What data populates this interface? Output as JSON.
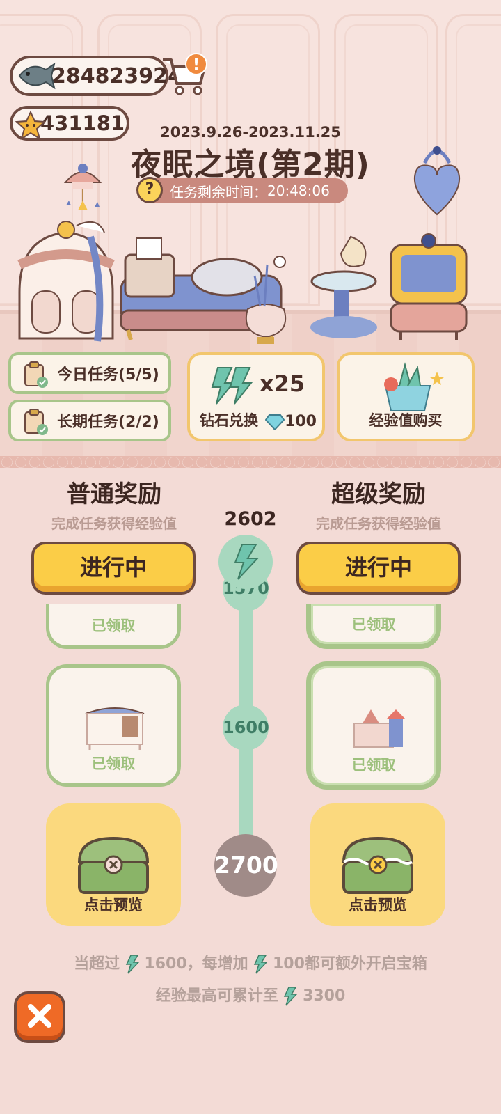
{
  "currency": {
    "fish_count": "284823924",
    "star_count": "431181",
    "alert_badge": "!"
  },
  "event": {
    "dates": "2023.9.26-2023.11.25",
    "title": "夜眠之境(第2期)",
    "timer_label": "任务剩余时间：",
    "timer_value": "20:48:06",
    "help_symbol": "?"
  },
  "tasks": {
    "daily": "今日任务(5/5)",
    "long_term": "长期任务(2/2)"
  },
  "shop": {
    "diamond_exchange": {
      "quantity": "x25",
      "label": "钻石兑换",
      "price": "100"
    },
    "exp_purchase": {
      "label": "经验值购买"
    }
  },
  "rewards": {
    "normal": {
      "title": "普通奖励",
      "subtitle": "完成任务获得经验值",
      "button": "进行中"
    },
    "super": {
      "title": "超级奖励",
      "subtitle": "完成任务获得经验值",
      "button": "进行中"
    },
    "current_exp": "2602",
    "milestones": [
      "1570",
      "1600",
      "2700"
    ],
    "claimed_label": "已领取",
    "preview_label": "点击预览"
  },
  "footer": {
    "line1_a": "当超过",
    "line1_b": "1600，每增加",
    "line1_c": "100都可额外开启宝箱",
    "line2_a": "经验最高可累计至",
    "line2_b": "3300"
  },
  "colors": {
    "accent_yellow": "#fbcd47",
    "accent_green": "#a8c58a",
    "track_mint": "#a8d8bf",
    "close_orange": "#ef6a26"
  }
}
